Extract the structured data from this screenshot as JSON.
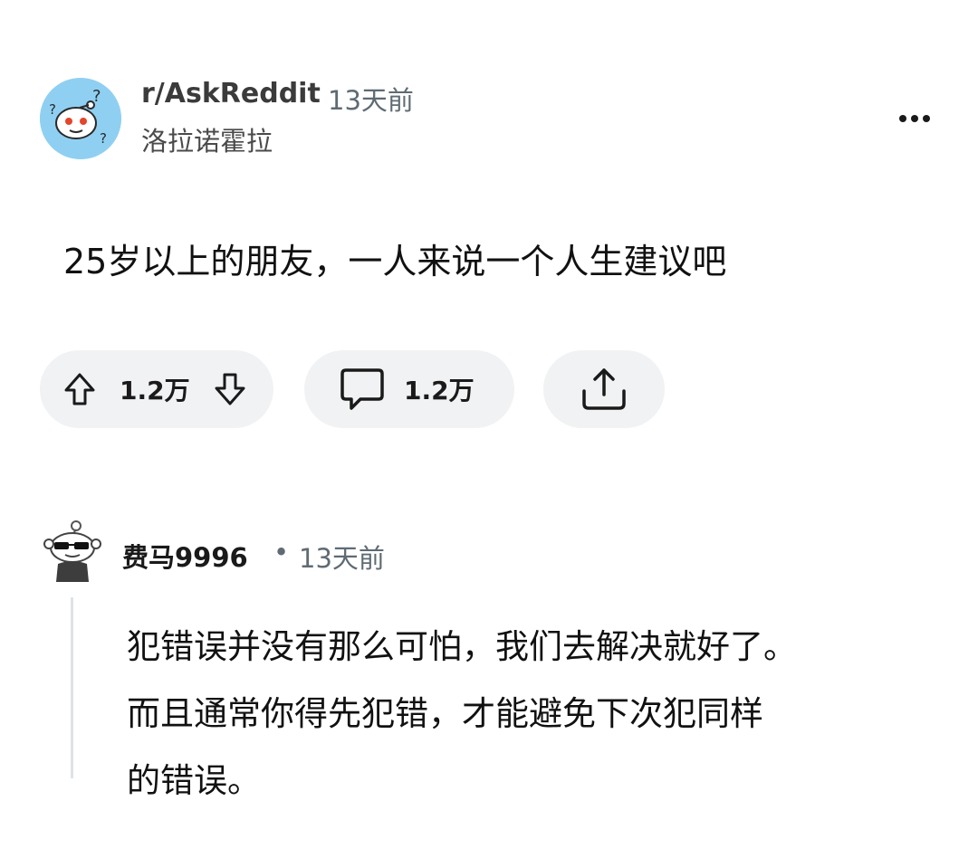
{
  "post": {
    "subreddit": "r/AskReddit",
    "time": "13天前",
    "author": "洛拉诺霍拉",
    "title": "25岁以上的朋友，一人来说一个人生建议吧",
    "votes": "1.2万",
    "comments": "1.2万",
    "icons": {
      "subreddit_avatar": "reddit-snoo-thinking-icon",
      "more": "more-horizontal-icon",
      "upvote": "arrow-up-icon",
      "downvote": "arrow-down-icon",
      "comment": "comment-bubble-icon",
      "share": "share-icon"
    }
  },
  "comment": {
    "user": "费马9996",
    "separator": "•",
    "time": "13天前",
    "body_lines": [
      "犯错误并没有那么可怕，我们去解决就好了。",
      "而且通常你得先犯错，才能避免下次犯同样",
      "的错误。"
    ],
    "icons": {
      "avatar": "snoo-sunglasses-avatar-icon"
    }
  },
  "colors": {
    "pill_bg": "#f1f2f3",
    "avatar_bg": "#8fd0f2",
    "meta_text": "#5f6b73"
  }
}
